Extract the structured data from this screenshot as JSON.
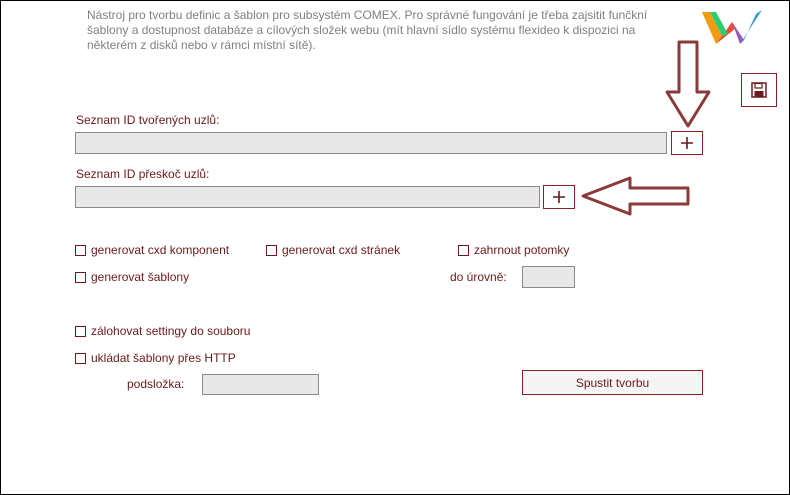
{
  "description": "Nástroj pro tvorbu definic a šablon pro subsystém COMEX. Pro správné fungování je třeba zajsitit funčkní šablony a dostupnost databáze a cílových složek webu (mít hlavní sídlo systému flexideo k dispozici na některém z disků nebo v rámci místní sítě).",
  "icons": {
    "logo": "flexideo-logo-icon",
    "save": "floppy-disk-icon",
    "add": "plus-icon",
    "arrow": "arrow-annotation-icon"
  },
  "colors": {
    "accent": "#8b2020",
    "label": "#6b1a1a",
    "input_bg": "#e8e8e8",
    "description": "#808080"
  },
  "nodes_created": {
    "label": "Seznam ID tvořených uzlů:",
    "value": ""
  },
  "nodes_skipped": {
    "label": "Seznam ID přeskoč uzlů:",
    "value": ""
  },
  "options": {
    "gen_cxd_components": {
      "label": "generovat cxd komponent",
      "checked": false
    },
    "gen_cxd_pages": {
      "label": "generovat cxd stránek",
      "checked": false
    },
    "include_children": {
      "label": "zahrnout potomky",
      "checked": false
    },
    "gen_templates": {
      "label": "generovat šablony",
      "checked": false
    },
    "level": {
      "label": "do úrovně:",
      "value": ""
    },
    "backup_settings": {
      "label": "zálohovat settingy do souboru",
      "checked": false
    },
    "save_http": {
      "label": "ukládat šablony přes HTTP",
      "checked": false
    },
    "subfolder": {
      "label": "podsložka:",
      "value": ""
    }
  },
  "run_button": {
    "label": "Spustit tvorbu"
  }
}
